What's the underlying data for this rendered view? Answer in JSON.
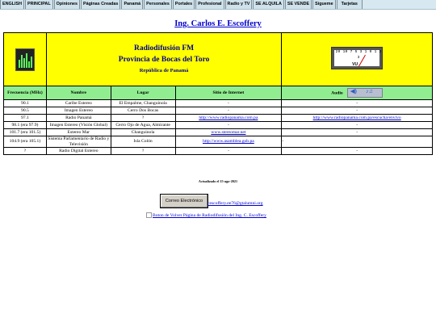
{
  "nav": {
    "items": [
      "ENGLISH",
      "PRINCIPAL",
      "Opiniones",
      "Páginas Creadas",
      "Panamá",
      "Personales",
      "Portales",
      "Profesional",
      "Radio y TV",
      "SE ALQUILA",
      "SE VENDE",
      "Sígueme",
      "Tarjetas"
    ]
  },
  "headline": "Ing. Carlos E. Escoffery",
  "banner": {
    "line1": "Radiodifusión FM",
    "line2": "Provincia de Bocas del Toro",
    "line3": "República de Panamá",
    "meter_scale": "20 10 7 5 3 1 0 1 2 3",
    "meter_label": "VU"
  },
  "table": {
    "headers": [
      "Frecuencia (MHz)",
      "Nombre",
      "Lugar",
      "Sitio de Internet",
      "Audio"
    ],
    "rows": [
      [
        "90.1",
        "Caribe Estereo",
        "El Empalme, Changuinola",
        "-",
        "-"
      ],
      [
        "90.5",
        "Imagen Estereo",
        "Cerro Dos Bocas",
        "-",
        "-"
      ],
      [
        "97.1",
        "Radio Panamá",
        "?",
        "http://www.radiopanama.com.pa",
        "http://www.radiopanama.com.pa/escucha/envivo"
      ],
      [
        "98.1 (era 97.9)",
        "Imagen Estereo (Visión Global)",
        "Cerro Ojo de Agua, Almirante",
        "-",
        "-"
      ],
      [
        "101.7 (era 101.5)",
        "Estereo Mar",
        "Changuinola",
        "www.stereomar.net",
        "-"
      ],
      [
        "104.9 (era 105.1)",
        "Sistema Parlamentario de Radio y Televisión",
        "Isla Colón",
        "http://www.asamblea.gob.pa",
        "-"
      ],
      [
        "?",
        "Radio Digital Estereo",
        "?",
        "-",
        "-"
      ]
    ]
  },
  "footer": {
    "updated": "Actualizado el 15-ago-2021",
    "email_button": "Correo Electrónico",
    "email_link": "cescoffery.ee76@gtalumni.org",
    "back_link": "Boton de Volver Página de Radiodifusión del Ing. C. Escoffery"
  },
  "colors": {
    "banner_bg": "#ffff00",
    "header_bg": "#90ee90",
    "link": "#0000cc",
    "title": "#00008b"
  }
}
